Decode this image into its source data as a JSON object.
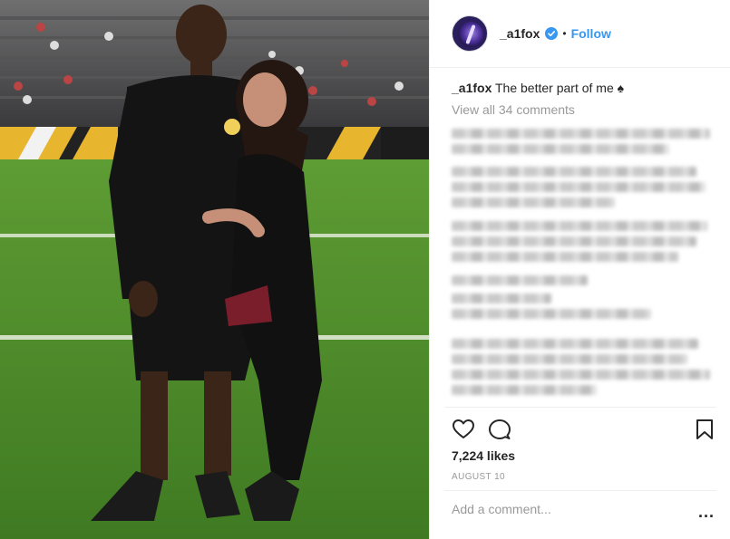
{
  "post": {
    "photo": {
      "icon": "stadium-couple-photo"
    },
    "header": {
      "username": "_a1fox",
      "verified_icon": "verified-badge-icon",
      "separator": "•",
      "follow_label": "Follow"
    },
    "caption": {
      "username": "_a1fox",
      "text": "The better part of me ♠"
    },
    "view_all_comments": "View all 34 comments",
    "actions": {
      "like_icon": "heart-icon",
      "comment_icon": "comment-icon",
      "save_icon": "bookmark-icon"
    },
    "likes": "7,224 likes",
    "date": "AUGUST 10",
    "add_comment": {
      "placeholder": "Add a comment...",
      "more_label": "..."
    },
    "colors": {
      "link": "#3897f0",
      "text": "#262626",
      "muted": "#999999",
      "divider": "#efefef"
    }
  }
}
